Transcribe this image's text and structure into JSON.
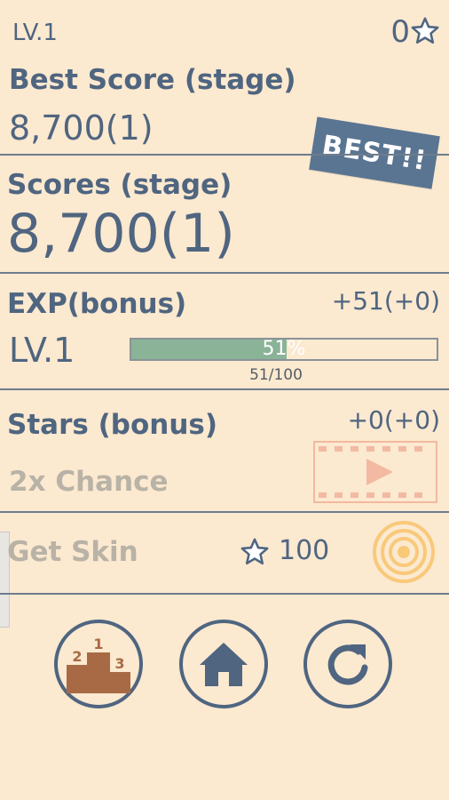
{
  "header": {
    "level": "LV.1",
    "stars": "0"
  },
  "best_score": {
    "title": "Best Score (stage)",
    "value": "8,700(1)",
    "badge": "BEST!!"
  },
  "scores": {
    "title": "Scores (stage)",
    "value": "8,700(1)"
  },
  "exp": {
    "title": "EXP(bonus)",
    "gain": "+51(+0)",
    "level": "LV.1",
    "percent_label": "51%",
    "progress": 0.51,
    "fraction": "51/100"
  },
  "stars_bonus": {
    "title": "Stars (bonus)",
    "gain": "+0(+0)",
    "chance_label": "2x Chance"
  },
  "skin": {
    "label": "Get Skin",
    "price": "100"
  },
  "nav": {
    "icons": [
      "leaderboard-icon",
      "home-icon",
      "retry-icon"
    ],
    "podium_numbers": [
      "1",
      "2",
      "3"
    ]
  },
  "colors": {
    "background": "#fbe9d0",
    "text": "#4f6580",
    "accent_bar": "#8ab397",
    "video_button": "#f3b9a2",
    "target_button": "#f9c97a",
    "podium": "#a86a45"
  }
}
